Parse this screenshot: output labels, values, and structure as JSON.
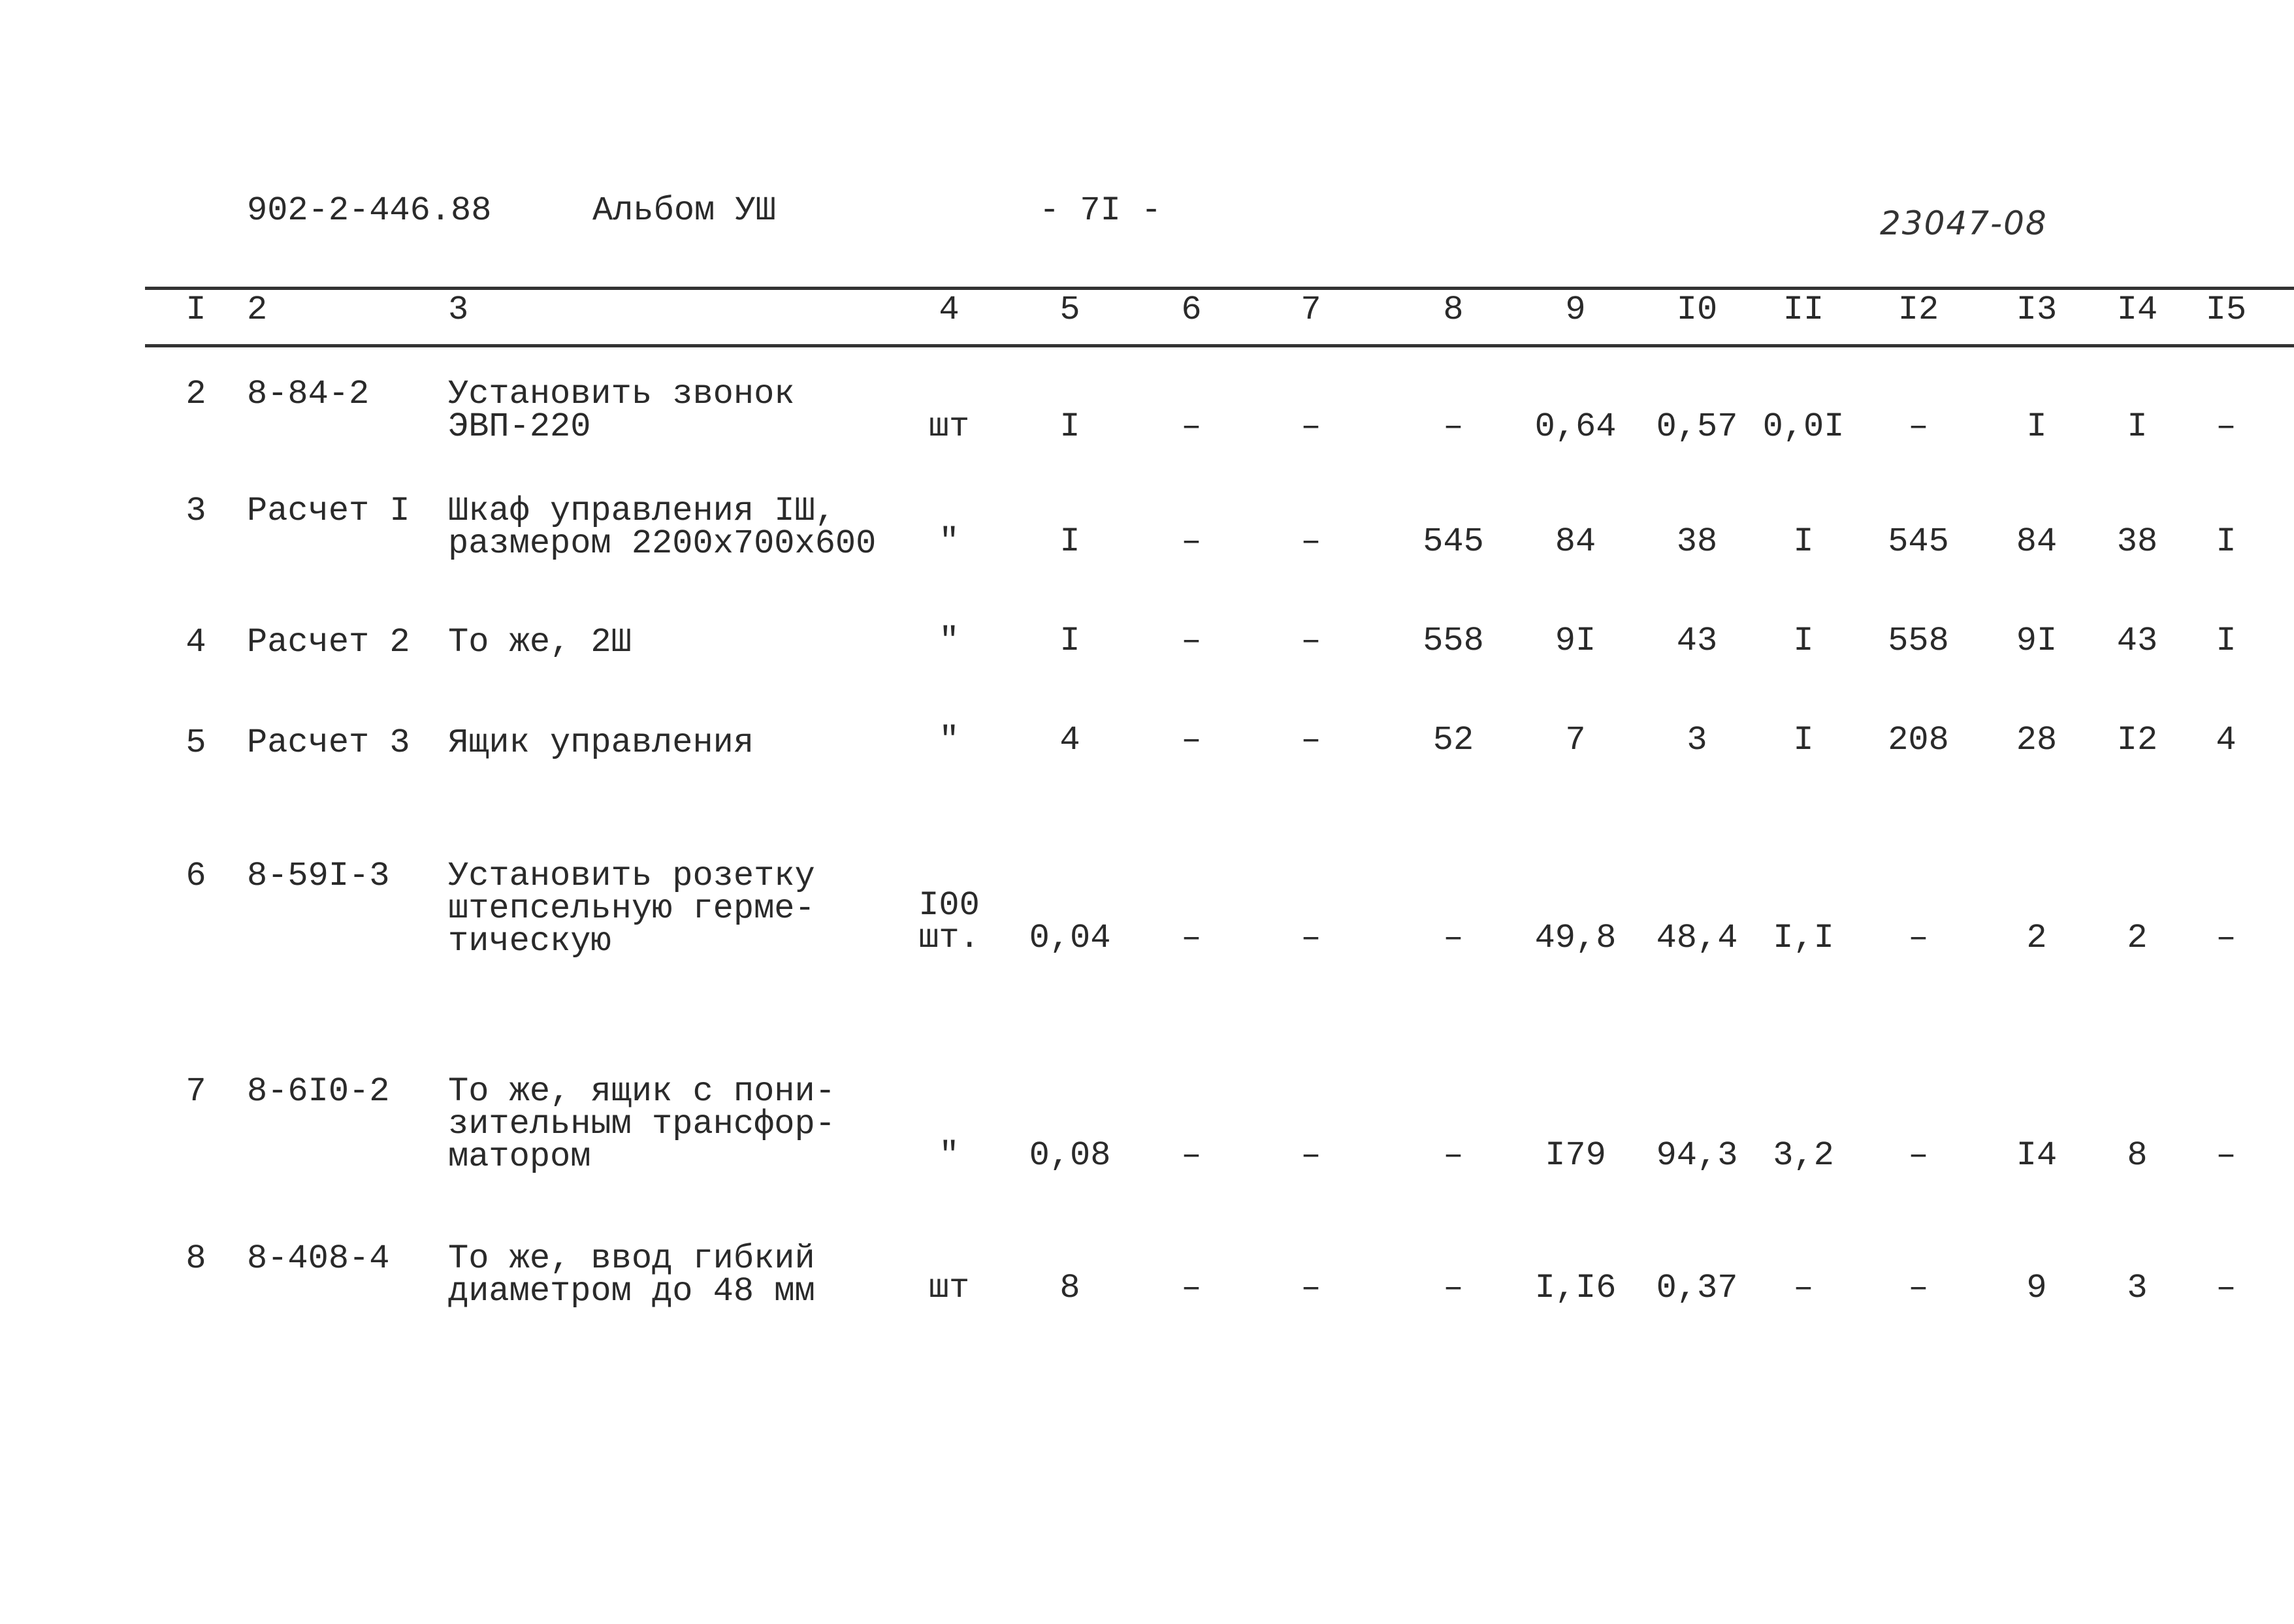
{
  "header": {
    "doc_code": "902-2-446.88",
    "album": "Альбом УШ",
    "page": "- 7I -",
    "handwritten_number": "23047-08"
  },
  "columns": [
    "I",
    "2",
    "3",
    "4",
    "5",
    "6",
    "7",
    "8",
    "9",
    "I0",
    "II",
    "I2",
    "I3",
    "I4",
    "I5"
  ],
  "rows": [
    {
      "n": "2",
      "code": "8-84-2",
      "desc": [
        "Установить звонок",
        "ЭВП-220"
      ],
      "unit": [
        "шт"
      ],
      "values": [
        "I",
        "–",
        "–",
        "–",
        "0,64",
        "0,57",
        "0,0I",
        "–",
        "I",
        "I",
        "–"
      ]
    },
    {
      "n": "3",
      "code": "Расчет I",
      "desc": [
        "Шкаф управления IШ,",
        "размером 2200х700х600"
      ],
      "unit": [
        "\""
      ],
      "values": [
        "I",
        "–",
        "–",
        "545",
        "84",
        "38",
        "I",
        "545",
        "84",
        "38",
        "I"
      ]
    },
    {
      "n": "4",
      "code": "Расчет 2",
      "desc": [
        "То же, 2Ш"
      ],
      "unit": [
        "\""
      ],
      "values": [
        "I",
        "–",
        "–",
        "558",
        "9I",
        "43",
        "I",
        "558",
        "9I",
        "43",
        "I"
      ]
    },
    {
      "n": "5",
      "code": "Расчет 3",
      "desc": [
        "Ящик управления"
      ],
      "unit": [
        "\""
      ],
      "values": [
        "4",
        "–",
        "–",
        "52",
        "7",
        "3",
        "I",
        "208",
        "28",
        "I2",
        "4"
      ]
    },
    {
      "n": "6",
      "code": "8-59I-3",
      "desc": [
        "Установить розетку",
        "штепсельную герме-",
        "тическую"
      ],
      "unit": [
        "I00",
        "шт."
      ],
      "values": [
        "0,04",
        "–",
        "–",
        "–",
        "49,8",
        "48,4",
        "I,I",
        "–",
        "2",
        "2",
        "–"
      ]
    },
    {
      "n": "7",
      "code": "8-6I0-2",
      "desc": [
        "То же, ящик с пони-",
        "зительным трансфор-",
        "матором"
      ],
      "unit": [
        "\""
      ],
      "values": [
        "0,08",
        "–",
        "–",
        "–",
        "I79",
        "94,3",
        "3,2",
        "–",
        "I4",
        "8",
        "–"
      ]
    },
    {
      "n": "8",
      "code": "8-408-4",
      "desc": [
        "То же, ввод гибкий",
        "диаметром до 48 мм"
      ],
      "unit": [
        "шт"
      ],
      "values": [
        "8",
        "–",
        "–",
        "–",
        "I,I6",
        "0,37",
        "–",
        "–",
        "9",
        "3",
        "–"
      ]
    }
  ]
}
